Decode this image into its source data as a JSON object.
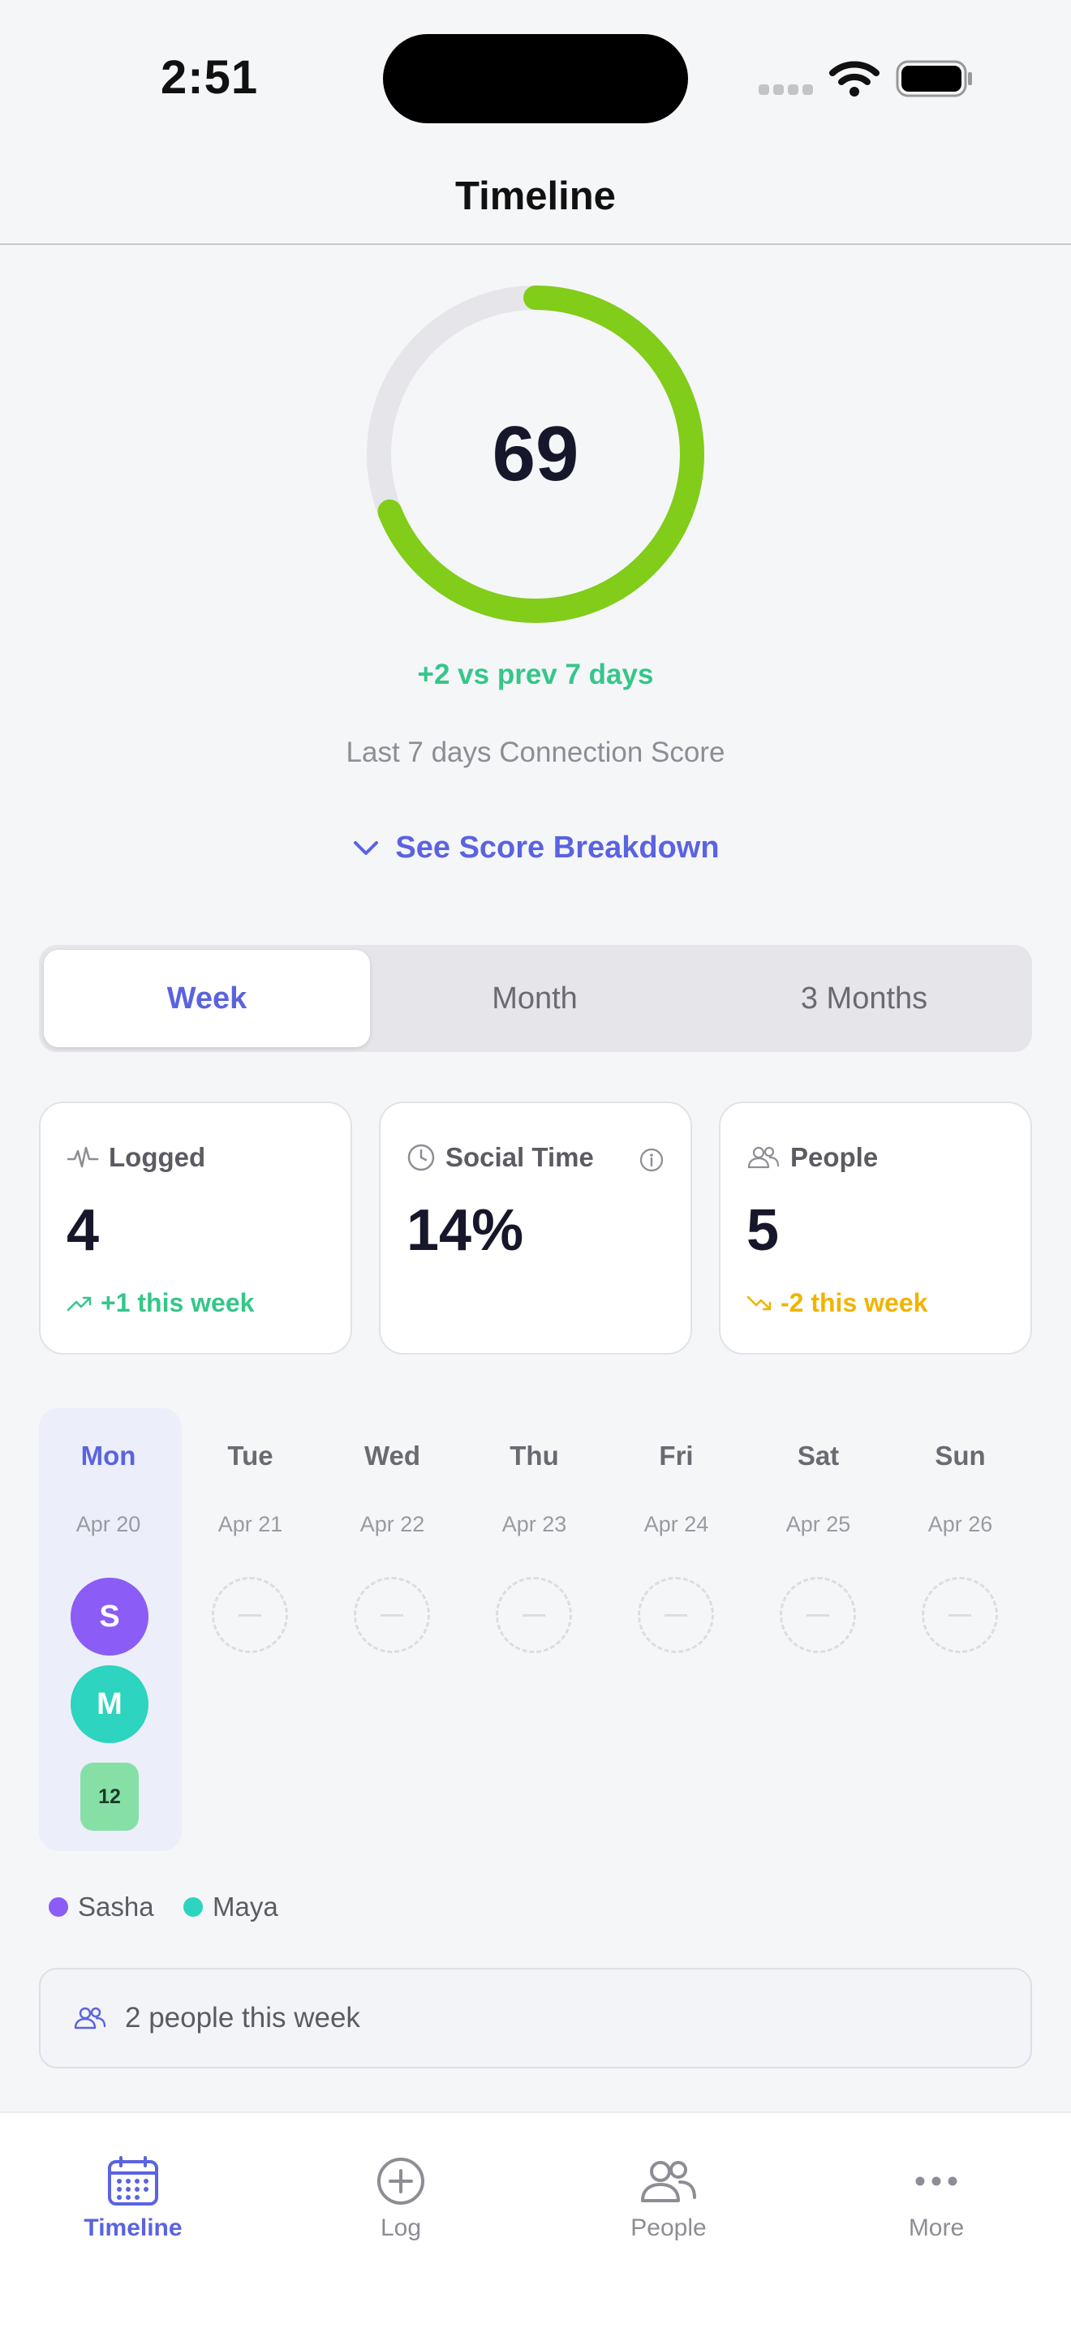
{
  "status_bar": {
    "time": "2:51"
  },
  "nav": {
    "title": "Timeline"
  },
  "score": {
    "value": "69",
    "progress": 0.69,
    "delta_text": "+2 vs prev 7 days",
    "subtitle": "Last 7 days Connection Score",
    "breakdown_label": "See Score Breakdown",
    "ring_color": "#82cc1a"
  },
  "range_tabs": [
    {
      "label": "Week",
      "active": true
    },
    {
      "label": "Month",
      "active": false
    },
    {
      "label": "3 Months",
      "active": false
    }
  ],
  "stats": [
    {
      "label": "Logged",
      "value": "4",
      "trend": "+1 this week",
      "trend_color": "#35c68a",
      "icon": "pulse-icon"
    },
    {
      "label": "Social Time",
      "value": "14%",
      "trend": "",
      "icon": "clock-icon"
    },
    {
      "label": "People",
      "value": "5",
      "trend": "-2 this week",
      "trend_color": "#f0b400",
      "icon": "people-icon"
    }
  ],
  "week": {
    "days": [
      {
        "name": "Mon",
        "date": "Apr 20",
        "selected": true
      },
      {
        "name": "Tue",
        "date": "Apr 21"
      },
      {
        "name": "Wed",
        "date": "Apr 22"
      },
      {
        "name": "Thu",
        "date": "Apr 23"
      },
      {
        "name": "Fri",
        "date": "Apr 24"
      },
      {
        "name": "Sat",
        "date": "Apr 25"
      },
      {
        "name": "Sun",
        "date": "Apr 26"
      }
    ],
    "mon_entries": [
      {
        "initial": "S",
        "color": "#8b5cf6"
      },
      {
        "initial": "M",
        "color": "#2dd4bf"
      }
    ],
    "mon_badge": "12"
  },
  "legend": [
    {
      "name": "Sasha",
      "color": "#8b5cf6"
    },
    {
      "name": "Maya",
      "color": "#2dd4bf"
    }
  ],
  "summary": {
    "text": "2 people this week"
  },
  "tab_bar": [
    {
      "label": "Timeline",
      "icon": "calendar-icon",
      "active": true
    },
    {
      "label": "Log",
      "icon": "plus-circle-icon"
    },
    {
      "label": "People",
      "icon": "people-icon"
    },
    {
      "label": "More",
      "icon": "more-icon"
    }
  ]
}
